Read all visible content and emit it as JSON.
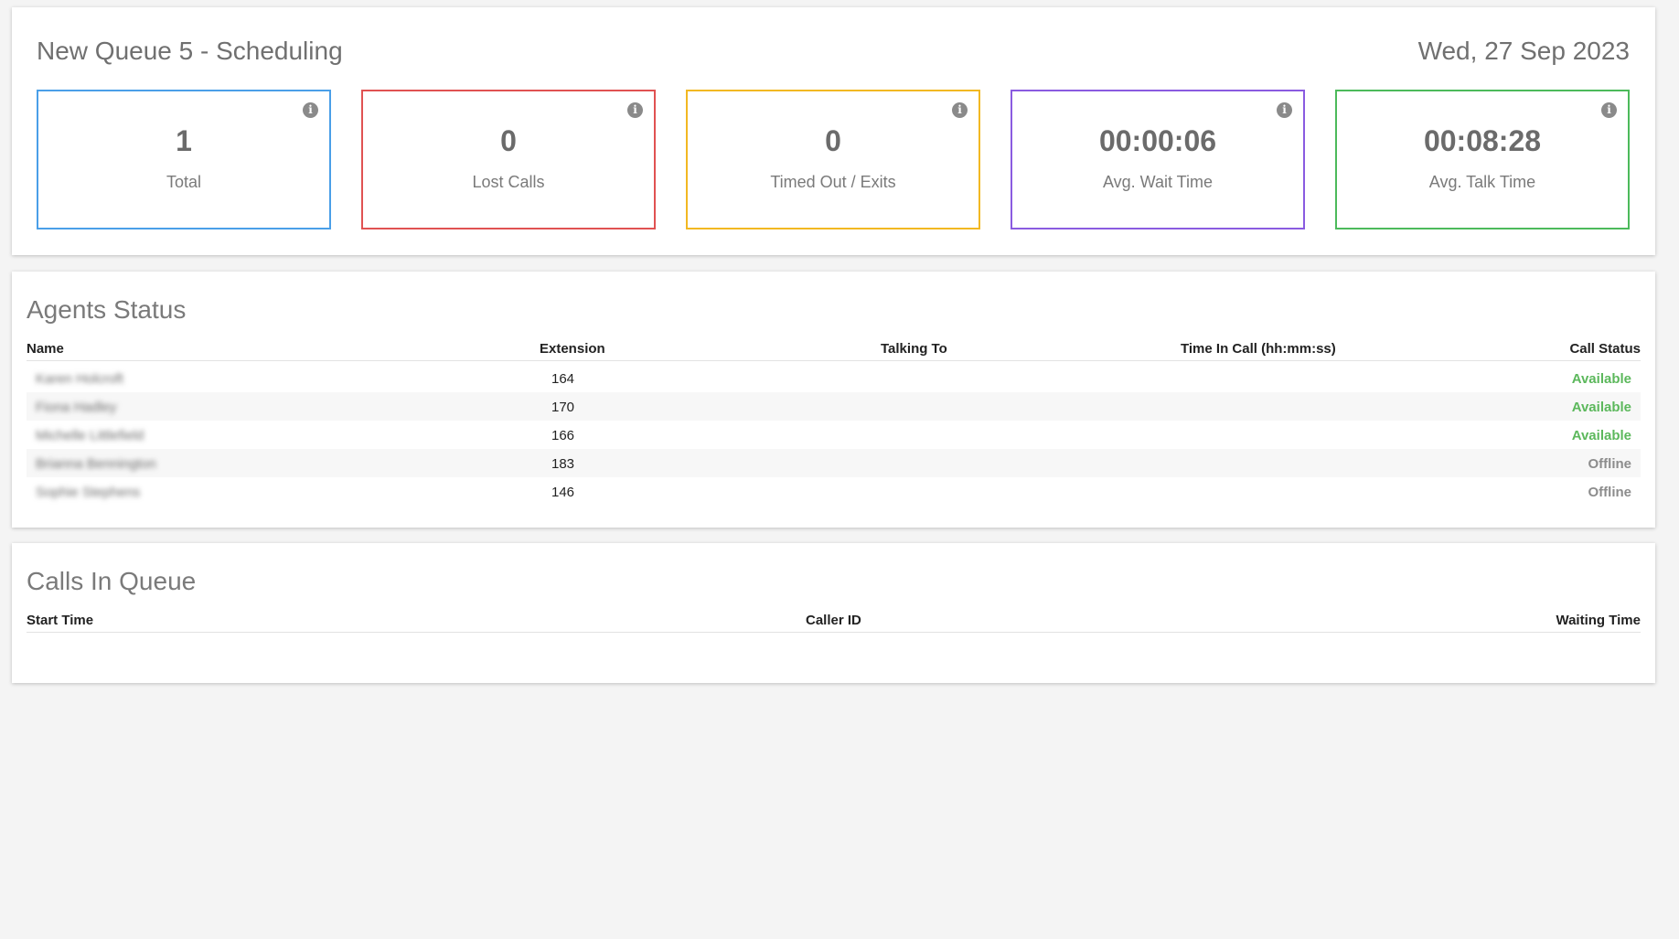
{
  "header": {
    "queue_title": "New Queue 5 - Scheduling",
    "date": "Wed, 27 Sep 2023"
  },
  "stats": [
    {
      "value": "1",
      "label": "Total",
      "color": "#4a9fe8"
    },
    {
      "value": "0",
      "label": "Lost Calls",
      "color": "#e05252"
    },
    {
      "value": "0",
      "label": "Timed Out / Exits",
      "color": "#f2b822"
    },
    {
      "value": "00:00:06",
      "label": "Avg. Wait Time",
      "color": "#8a5be0"
    },
    {
      "value": "00:08:28",
      "label": "Avg. Talk Time",
      "color": "#4cba5b"
    }
  ],
  "info_icon": "info-icon",
  "agents": {
    "title": "Agents Status",
    "columns": [
      "Name",
      "Extension",
      "Talking To",
      "Time In Call (hh:mm:ss)",
      "Call Status"
    ],
    "rows": [
      {
        "name": "Karen Holcroft",
        "extension": "164",
        "talking_to": "",
        "time_in_call": "",
        "status": "Available"
      },
      {
        "name": "Fiona Hadley",
        "extension": "170",
        "talking_to": "",
        "time_in_call": "",
        "status": "Available"
      },
      {
        "name": "Michelle Littlefield",
        "extension": "166",
        "talking_to": "",
        "time_in_call": "",
        "status": "Available"
      },
      {
        "name": "Brianna Bennington",
        "extension": "183",
        "talking_to": "",
        "time_in_call": "",
        "status": "Offline"
      },
      {
        "name": "Sophie Stephens",
        "extension": "146",
        "talking_to": "",
        "time_in_call": "",
        "status": "Offline"
      }
    ]
  },
  "queue": {
    "title": "Calls In Queue",
    "columns": [
      "Start Time",
      "Caller ID",
      "Waiting Time"
    ],
    "rows": []
  }
}
